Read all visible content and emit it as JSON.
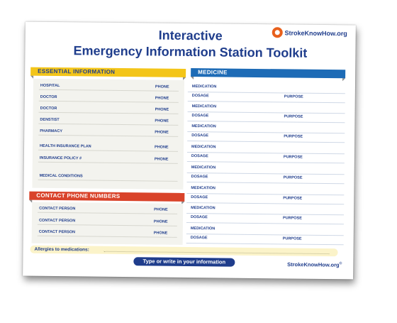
{
  "header": {
    "title_line1": "Interactive",
    "title_line2": "Emergency Information Station Toolkit",
    "logo_text": "StrokeKnowHow.org"
  },
  "essential": {
    "heading": "ESSENTIAL INFORMATION",
    "rows": [
      {
        "label": "HOSPITAL",
        "field": "PHONE"
      },
      {
        "label": "DOCTOR",
        "field": "PHONE"
      },
      {
        "label": "DOCTOR",
        "field": "PHONE"
      },
      {
        "label": "DENSTIST",
        "field": "PHONE"
      },
      {
        "label": "PHARMACY",
        "field": "PHONE"
      },
      {
        "label": "HEALTH INSURANCE PLAN",
        "field": "PHONE"
      },
      {
        "label": "INSURANCE POLICY #",
        "field": "PHONE"
      },
      {
        "label": "MEDICAL CONDITIONS",
        "field": ""
      }
    ]
  },
  "contacts": {
    "heading": "CONTACT PHONE NUMBERS",
    "rows": [
      {
        "label": "CONTACT PERSON",
        "field": "PHONE"
      },
      {
        "label": "CONTACT PERSON",
        "field": "PHONE"
      },
      {
        "label": "CONTACT PERSON",
        "field": "PHONE"
      }
    ]
  },
  "medicine": {
    "heading": "MEDICINE",
    "medication_label": "MEDICATION",
    "dosage_label": "DOSAGE",
    "purpose_label": "PURPOSE",
    "entries": 8
  },
  "allergies_label": "Allergies to medications:",
  "cta": "Type or write in your information",
  "footer": {
    "brand": "StrokeKnowHow.org",
    "mark": "©"
  },
  "colors": {
    "navy": "#1f3d8c",
    "yellow": "#f3c519",
    "red": "#d9432a",
    "blue": "#1d6bb6",
    "orange": "#e8601c"
  }
}
